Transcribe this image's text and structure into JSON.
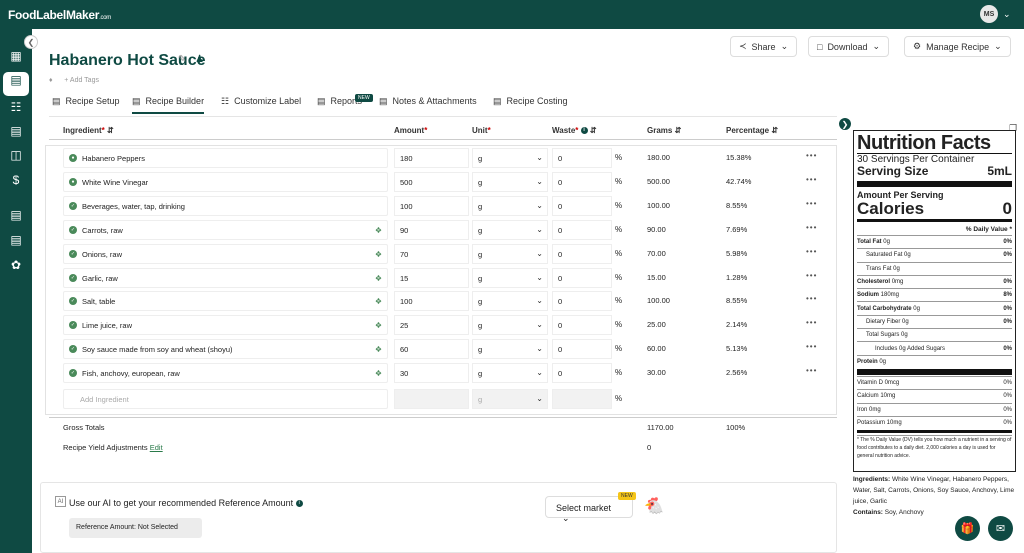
{
  "brand": {
    "logo": "FoodLabelMaker",
    "logo_suffix": ".com"
  },
  "user": {
    "initials": "MS"
  },
  "recipe": {
    "title": "Habanero Hot Sauce",
    "add_tags": "Add Tags"
  },
  "header_buttons": {
    "share": "Share",
    "download": "Download",
    "manage": "Manage Recipe"
  },
  "tabs": [
    {
      "label": "Recipe Setup"
    },
    {
      "label": "Recipe Builder",
      "active": true
    },
    {
      "label": "Customize Label"
    },
    {
      "label": "Reports",
      "badge": "NEW"
    },
    {
      "label": "Notes & Attachments"
    },
    {
      "label": "Recipe Costing"
    }
  ],
  "columns": {
    "ingredient": "Ingredient",
    "amount": "Amount",
    "unit": "Unit",
    "waste": "Waste",
    "grams": "Grams",
    "percentage": "Percentage",
    "req": "*"
  },
  "rows": [
    {
      "name": "Habanero Peppers",
      "amount": "180",
      "unit": "g",
      "waste": "0",
      "pct_sign": "%",
      "grams": "180.00",
      "percentage": "15.38%",
      "tagged": false,
      "person": true
    },
    {
      "name": "White Wine Vinegar",
      "amount": "500",
      "unit": "g",
      "waste": "0",
      "pct_sign": "%",
      "grams": "500.00",
      "percentage": "42.74%",
      "tagged": false,
      "person": true
    },
    {
      "name": "Beverages, water, tap, drinking",
      "amount": "100",
      "unit": "g",
      "waste": "0",
      "pct_sign": "%",
      "grams": "100.00",
      "percentage": "8.55%",
      "tagged": false
    },
    {
      "name": "Carrots, raw",
      "amount": "90",
      "unit": "g",
      "waste": "0",
      "pct_sign": "%",
      "grams": "90.00",
      "percentage": "7.69%",
      "tagged": true
    },
    {
      "name": "Onions, raw",
      "amount": "70",
      "unit": "g",
      "waste": "0",
      "pct_sign": "%",
      "grams": "70.00",
      "percentage": "5.98%",
      "tagged": true
    },
    {
      "name": "Garlic, raw",
      "amount": "15",
      "unit": "g",
      "waste": "0",
      "pct_sign": "%",
      "grams": "15.00",
      "percentage": "1.28%",
      "tagged": true
    },
    {
      "name": "Salt, table",
      "amount": "100",
      "unit": "g",
      "waste": "0",
      "pct_sign": "%",
      "grams": "100.00",
      "percentage": "8.55%",
      "tagged": true
    },
    {
      "name": "Lime juice, raw",
      "amount": "25",
      "unit": "g",
      "waste": "0",
      "pct_sign": "%",
      "grams": "25.00",
      "percentage": "2.14%",
      "tagged": true
    },
    {
      "name": "Soy sauce made from soy and wheat (shoyu)",
      "amount": "60",
      "unit": "g",
      "waste": "0",
      "pct_sign": "%",
      "grams": "60.00",
      "percentage": "5.13%",
      "tagged": true
    },
    {
      "name": "Fish, anchovy, european, raw",
      "amount": "30",
      "unit": "g",
      "waste": "0",
      "pct_sign": "%",
      "grams": "30.00",
      "percentage": "2.56%",
      "tagged": true
    }
  ],
  "new_row": {
    "placeholder": "Add Ingredient",
    "unit": "g",
    "pct_sign": "%"
  },
  "totals": {
    "label": "Gross Totals",
    "grams": "1170.00",
    "percentage": "100%",
    "yield_label": "Recipe Yield Adjustments",
    "yield_link": "Edit",
    "yield_value": "0"
  },
  "ai_panel": {
    "text": "Use our AI to get your recommended Reference Amount",
    "reference": "Reference Amount: Not Selected",
    "market": "Select market",
    "market_badge": "NEW"
  },
  "nutrition": {
    "title": "Nutrition Facts",
    "servings": "30 Servings Per Container",
    "serving_size_label": "Serving Size",
    "serving_size": "5mL",
    "amount_per": "Amount Per Serving",
    "calories_label": "Calories",
    "calories": "0",
    "dv_header": "% Daily Value *",
    "rows": [
      {
        "label": "Total Fat",
        "value": "0g",
        "dv": "0%",
        "bold": true,
        "indent": 0
      },
      {
        "label": "Saturated Fat",
        "value": "0g",
        "dv": "0%",
        "bold": false,
        "indent": 1
      },
      {
        "label": "Trans Fat",
        "value": "0g",
        "dv": "",
        "bold": false,
        "indent": 1,
        "italic_word": "Trans"
      },
      {
        "label": "Cholesterol",
        "value": "0mg",
        "dv": "0%",
        "bold": true,
        "indent": 0
      },
      {
        "label": "Sodium",
        "value": "180mg",
        "dv": "8%",
        "bold": true,
        "indent": 0
      },
      {
        "label": "Total Carbohydrate",
        "value": "0g",
        "dv": "0%",
        "bold": true,
        "indent": 0
      },
      {
        "label": "Dietary Fiber",
        "value": "0g",
        "dv": "0%",
        "bold": false,
        "indent": 1
      },
      {
        "label": "Total Sugars",
        "value": "0g",
        "dv": "",
        "bold": false,
        "indent": 1
      },
      {
        "label": "Includes 0g Added Sugars",
        "value": "",
        "dv": "0%",
        "bold": false,
        "indent": 2
      },
      {
        "label": "Protein",
        "value": "0g",
        "dv": "",
        "bold": true,
        "indent": 0
      }
    ],
    "vitamins": [
      {
        "label": "Vitamin D 0mcg",
        "dv": "0%"
      },
      {
        "label": "Calcium 10mg",
        "dv": "0%"
      },
      {
        "label": "Iron 0mg",
        "dv": "0%"
      },
      {
        "label": "Potassium 10mg",
        "dv": "0%"
      }
    ],
    "footnote": "* The % Daily Value (DV) tells you how much a nutrient in a serving of food contributes to a daily diet. 2,000 calories a day is used for general nutrition advice.",
    "ingredients_label": "Ingredients:",
    "ingredients": "White Wine Vinegar, Habanero Peppers, Water, Salt, Carrots, Onions, Soy Sauce, Anchovy, Lime juice, Garlic",
    "contains_label": "Contains:",
    "contains": "Soy, Anchovy"
  },
  "colors": {
    "brand": "#0f4a43",
    "accent_green": "#4a8a5a",
    "required": "#cc0000"
  },
  "icons": [
    "dashboard-icon",
    "recipe-icon",
    "calendar-icon",
    "document-icon",
    "columns-icon",
    "dollar-icon",
    "clipboard-icon",
    "report-icon",
    "network-icon"
  ]
}
